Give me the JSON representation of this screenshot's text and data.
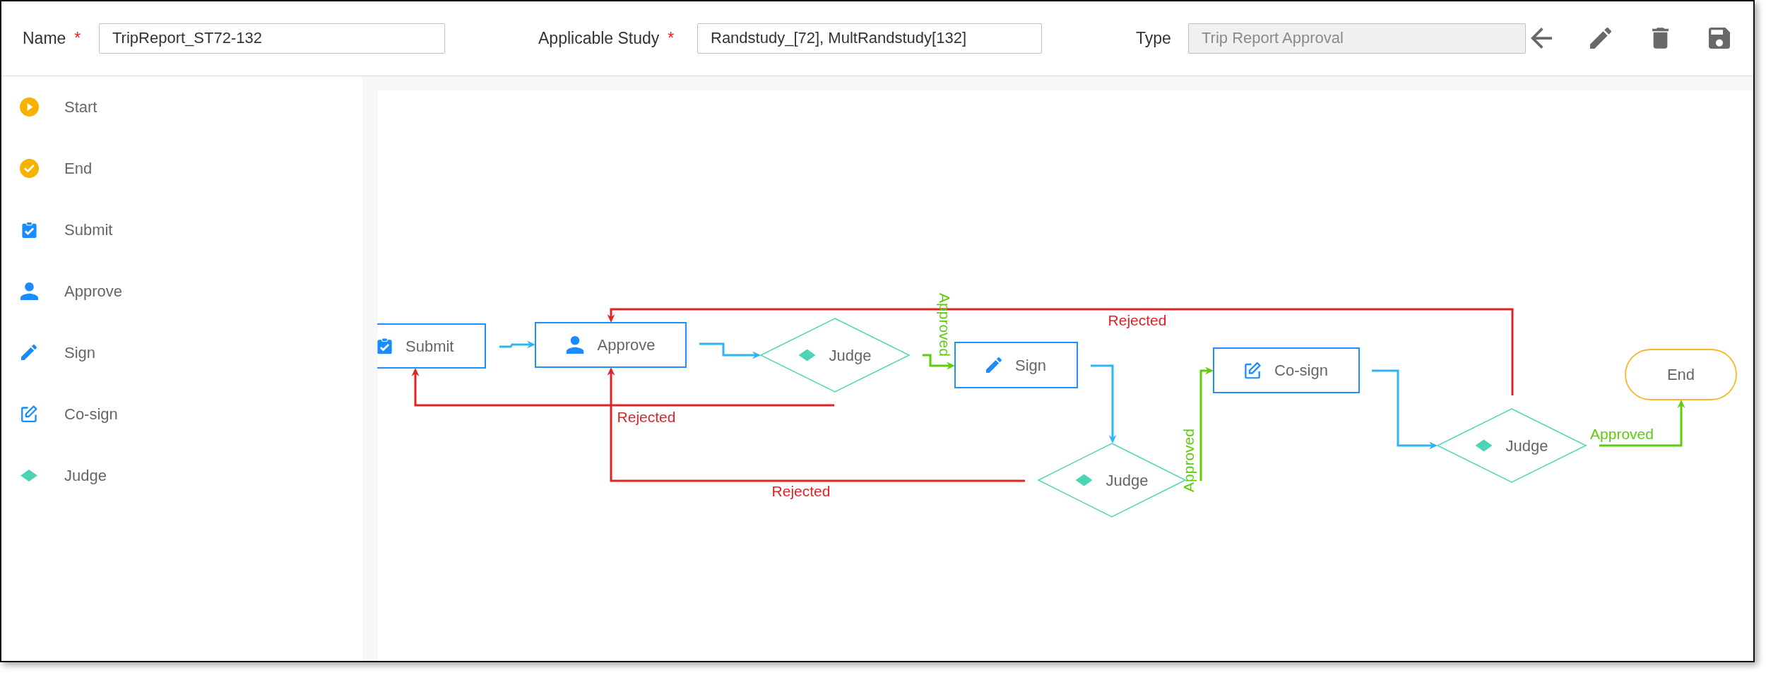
{
  "form": {
    "fields": [
      {
        "label": "Name",
        "required_mark": "*",
        "value": "TripReport_ST72-132",
        "disabled": false
      },
      {
        "label": "Applicable Study",
        "required_mark": "*",
        "value": "Randstudy_[72], MultRandstudy[132]",
        "disabled": false
      },
      {
        "label": "Type",
        "value": "Trip Report Approval",
        "disabled": true
      }
    ]
  },
  "palette": [
    {
      "kind": "start",
      "label": "Start"
    },
    {
      "kind": "end",
      "label": "End"
    },
    {
      "kind": "submit",
      "label": "Submit"
    },
    {
      "kind": "approve",
      "label": "Approve"
    },
    {
      "kind": "sign",
      "label": "Sign"
    },
    {
      "kind": "cosign",
      "label": "Co-sign"
    },
    {
      "kind": "judge",
      "label": "Judge"
    }
  ],
  "diagram": {
    "nodes": [
      {
        "kind": "submit",
        "label": "Submit"
      },
      {
        "kind": "approve",
        "label": "Approve"
      },
      {
        "kind": "judge",
        "label": "Judge"
      },
      {
        "kind": "sign",
        "label": "Sign"
      },
      {
        "kind": "judge",
        "label": "Judge"
      },
      {
        "kind": "cosign",
        "label": "Co-sign"
      },
      {
        "kind": "judge",
        "label": "Judge"
      },
      {
        "kind": "end",
        "label": "End"
      }
    ],
    "edges": [
      {
        "kind": "flow"
      },
      {
        "kind": "flow"
      },
      {
        "kind": "approved",
        "label": "Approved"
      },
      {
        "kind": "rejected",
        "label": "Rejected"
      },
      {
        "kind": "flow"
      },
      {
        "kind": "rejected",
        "label": "Rejected"
      },
      {
        "kind": "approved",
        "label": "Approved"
      },
      {
        "kind": "flow"
      },
      {
        "kind": "rejected",
        "label": "Rejected"
      },
      {
        "kind": "approved",
        "label": "Approved"
      }
    ]
  }
}
